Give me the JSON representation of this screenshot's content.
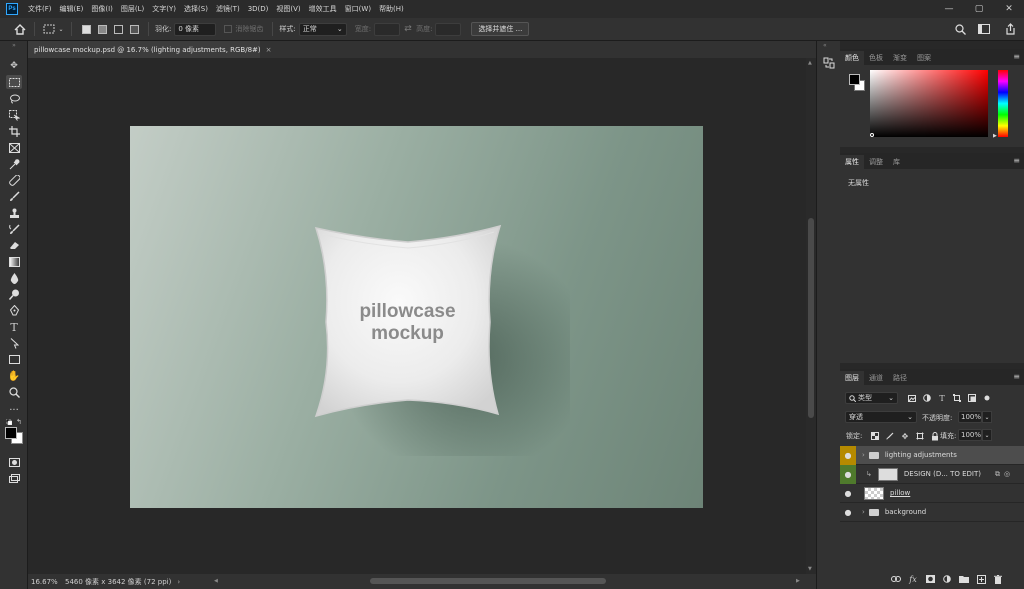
{
  "app": {
    "logo_text": "Ps"
  },
  "menu": [
    "文件(F)",
    "编辑(E)",
    "图像(I)",
    "图层(L)",
    "文字(Y)",
    "选择(S)",
    "滤镜(T)",
    "3D(D)",
    "视图(V)",
    "增效工具",
    "窗口(W)",
    "帮助(H)"
  ],
  "window_controls": {
    "minimize": "—",
    "maximize": "▢",
    "close": "✕"
  },
  "options": {
    "feather_label": "羽化:",
    "feather_value": "0 像素",
    "antialias_label": "消除锯齿",
    "style_label": "样式:",
    "style_value": "正常",
    "width_label": "宽度:",
    "height_label": "高度:",
    "select_mask_button": "选择并遮住 ..."
  },
  "document": {
    "tab_title": "pillowcase mockup.psd @ 16.7% (lighting adjustments, RGB/8#)",
    "tab_close": "×",
    "pillow_text_line1": "pillowcase",
    "pillow_text_line2": "mockup"
  },
  "status": {
    "zoom": "16.67%",
    "info": "5460 像素 x 3642 像素 (72 ppi)",
    "arrow": "›"
  },
  "color_panel": {
    "tabs": [
      "颜色",
      "色板",
      "渐变",
      "图案"
    ],
    "foreground_color": "#000000",
    "background_color": "#ffffff",
    "picker_hue": "#ff0000"
  },
  "properties_panel": {
    "tabs": [
      "属性",
      "调整",
      "库"
    ],
    "content": "无属性"
  },
  "layers_panel": {
    "tabs": [
      "图层",
      "通道",
      "路径"
    ],
    "filter_label": "类型",
    "blend_mode": "穿透",
    "opacity_label": "不透明度:",
    "opacity_value": "100%",
    "lock_label": "锁定:",
    "fill_label": "填充:",
    "fill_value": "100%",
    "layers": [
      {
        "name": "lighting adjustments",
        "type": "group",
        "eye_color": "#b58a00",
        "selected": true
      },
      {
        "name": "DESIGN (D... TO EDIT)",
        "type": "smart",
        "eye_color": "#4f7a2c",
        "selected": false
      },
      {
        "name": "pillow",
        "type": "pixel",
        "eye_color": "",
        "selected": false
      },
      {
        "name": "background",
        "type": "group",
        "eye_color": "",
        "selected": false
      }
    ],
    "footer_icons": [
      "link-icon",
      "fx-icon",
      "mask-icon",
      "adjustment-icon",
      "folder-icon",
      "new-layer-icon",
      "trash-icon"
    ]
  }
}
